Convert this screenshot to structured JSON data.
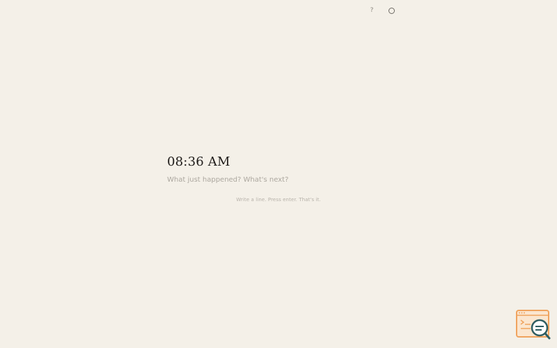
{
  "header": {
    "help_label": "?",
    "help_icon": "question-mark-icon",
    "theme_icon": "circle-icon"
  },
  "entry": {
    "time": "08:36 AM",
    "placeholder": "What just happened? What's next?",
    "value": ""
  },
  "hint": "Write a line. Press enter. That's it.",
  "badge": {
    "icon": "browser-search-icon"
  },
  "colors": {
    "background": "#f4f0e8",
    "text": "#1f1c1a",
    "muted": "#aca79f",
    "badge_orange": "#f0a35e",
    "badge_teal": "#2f5d62"
  }
}
